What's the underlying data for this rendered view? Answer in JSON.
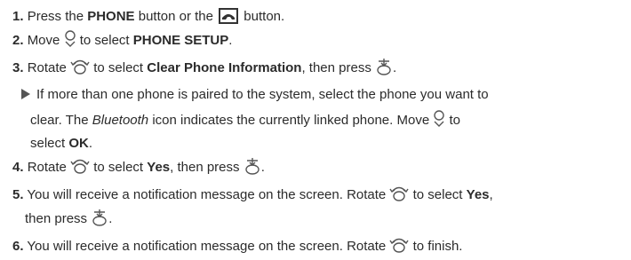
{
  "steps": [
    {
      "num": "1.",
      "t1": "Press the ",
      "b1": "PHONE",
      "t2": " button or the ",
      "t3": " button.",
      "icon": "phone-button-icon"
    },
    {
      "num": "2.",
      "t1": "Move ",
      "t2": " to select ",
      "b1": "PHONE SETUP",
      "t3": ".",
      "icon": "joystick-down-icon"
    },
    {
      "num": "3.",
      "t1": "Rotate ",
      "t2": " to select ",
      "b1": "Clear Phone Information",
      "t3": ", then press ",
      "t4": ".",
      "icon1": "rotary-knob-icon",
      "icon2": "enter-press-icon"
    },
    {
      "sub_t1": "If more than one phone is paired to the system, select the phone you want to",
      "sub_t2": "clear. The ",
      "sub_i1": "Bluetooth",
      "sub_t3": " icon indicates the currently linked phone. Move ",
      "sub_t4": " to",
      "sub_t5": "select ",
      "sub_b1": "OK",
      "sub_t6": ".",
      "icon": "joystick-down-icon"
    },
    {
      "num": "4.",
      "t1": "Rotate ",
      "t2": " to select ",
      "b1": "Yes",
      "t3": ", then press ",
      "t4": ".",
      "icon1": "rotary-knob-icon",
      "icon2": "enter-press-icon"
    },
    {
      "num": "5.",
      "t1": "You will receive a notification message on the screen. Rotate ",
      "t2": " to select ",
      "b1": "Yes",
      "t3": ",",
      "t4": "then press ",
      "t5": ".",
      "icon1": "rotary-knob-icon",
      "icon2": "enter-press-icon"
    },
    {
      "num": "6.",
      "t1": "You will receive a notification message on the screen. Rotate ",
      "t2": " to finish.",
      "icon": "rotary-knob-icon"
    }
  ]
}
